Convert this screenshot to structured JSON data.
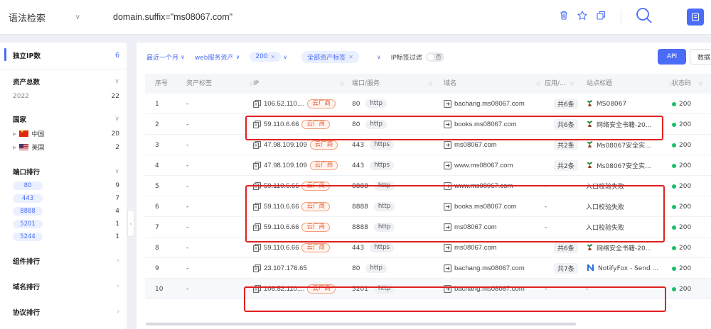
{
  "header": {
    "mode_label": "语法检索",
    "query": "domain.suffix=\"ms08067.com\""
  },
  "colors": {
    "accent": "#4a6cf7",
    "cloud_tag": "#e4572e",
    "status_ok": "#19be6b",
    "highlight": "#e02020"
  },
  "sidebar": {
    "unique_ip": {
      "label": "独立IP数",
      "count": "6"
    },
    "total_assets": {
      "label": "资产总数",
      "year": "2022",
      "count": "22"
    },
    "country": {
      "label": "国家",
      "items": [
        {
          "name": "中国",
          "count": "20"
        },
        {
          "name": "美国",
          "count": "2"
        }
      ]
    },
    "port_rank": {
      "label": "端口排行",
      "items": [
        {
          "port": "80",
          "count": "9"
        },
        {
          "port": "443",
          "count": "7"
        },
        {
          "port": "8888",
          "count": "4"
        },
        {
          "port": "5201",
          "count": "1"
        },
        {
          "port": "5244",
          "count": "1"
        }
      ]
    },
    "component_rank": {
      "label": "组件排行"
    },
    "domain_rank": {
      "label": "域名排行"
    },
    "protocol_rank": {
      "label": "协议排行"
    }
  },
  "filters": {
    "time": "最近一个月",
    "service": "web服务资产",
    "status_chip": "200",
    "tag_chip": "全部资产标签",
    "ip_tag_filter": "IP标签过滤",
    "toggle_off": "否",
    "api": "API",
    "data": "数据"
  },
  "table": {
    "columns": {
      "no": "序号",
      "tag": "资产标签",
      "ip": "IP",
      "port": "端口/服务",
      "domain": "域名",
      "app": "应用/...",
      "title": "站点标题",
      "status": "状态码"
    },
    "rows": [
      {
        "no": "1",
        "tag": "-",
        "ip": "106.52.110....",
        "cloud": "云厂商",
        "port": "80",
        "proto": "http",
        "domain": "bachang.ms08067.com",
        "app": "共6条",
        "title_icon": "plant-icon",
        "title": "MS08067",
        "status": "200"
      },
      {
        "no": "2",
        "tag": "-",
        "ip": "59.110.6.66",
        "cloud": "云厂商",
        "port": "80",
        "proto": "http",
        "domain": "books.ms08067.com",
        "app": "共6条",
        "title_icon": "plant-icon",
        "title": "网络安全书籍-20...",
        "status": "200"
      },
      {
        "no": "3",
        "tag": "-",
        "ip": "47.98.109.109",
        "cloud": "云厂商",
        "port": "443",
        "proto": "https",
        "domain": "ms08067.com",
        "app": "共2条",
        "title_icon": "plant-icon",
        "title": "Ms08067安全实...",
        "status": "200"
      },
      {
        "no": "4",
        "tag": "-",
        "ip": "47.98.109.109",
        "cloud": "云厂商",
        "port": "443",
        "proto": "https",
        "domain": "www.ms08067.com",
        "app": "共2条",
        "title_icon": "plant-icon",
        "title": "Ms08067安全实...",
        "status": "200"
      },
      {
        "no": "5",
        "tag": "-",
        "ip": "59.110.6.66",
        "cloud": "云厂商",
        "port": "8888",
        "proto": "http",
        "domain": "www.ms08067.com",
        "app": "-",
        "title_icon": "",
        "title": "入口校验失败",
        "status": "200"
      },
      {
        "no": "6",
        "tag": "-",
        "ip": "59.110.6.66",
        "cloud": "云厂商",
        "port": "8888",
        "proto": "http",
        "domain": "books.ms08067.com",
        "app": "-",
        "title_icon": "",
        "title": "入口校验失败",
        "status": "200"
      },
      {
        "no": "7",
        "tag": "-",
        "ip": "59.110.6.66",
        "cloud": "云厂商",
        "port": "8888",
        "proto": "http",
        "domain": "ms08067.com",
        "app": "-",
        "title_icon": "",
        "title": "入口校验失败",
        "status": "200"
      },
      {
        "no": "8",
        "tag": "-",
        "ip": "59.110.6.66",
        "cloud": "云厂商",
        "port": "443",
        "proto": "https",
        "domain": "ms08067.com",
        "app": "共6条",
        "title_icon": "plant-icon",
        "title": "网络安全书籍-20...",
        "status": "200"
      },
      {
        "no": "9",
        "tag": "-",
        "ip": "23.107.176.65",
        "cloud": "",
        "port": "80",
        "proto": "http",
        "domain": "bachang.ms08067.com",
        "app": "共7条",
        "title_icon": "notifyfox-icon",
        "title": "NotifyFox - Send ...",
        "status": "200"
      },
      {
        "no": "10",
        "tag": "-",
        "ip": "106.52.110....",
        "cloud": "云厂商",
        "port": "5201",
        "proto": "http",
        "domain": "bachang.ms08067.com",
        "app": "-",
        "title_icon": "",
        "title": "-",
        "status": "200"
      }
    ]
  }
}
